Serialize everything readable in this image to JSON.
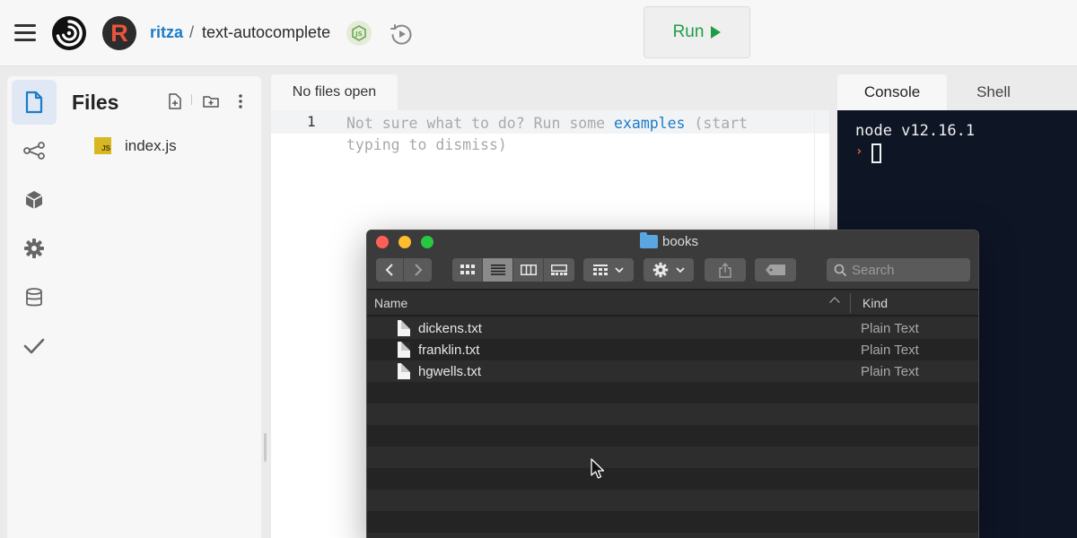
{
  "header": {
    "owner": "ritza",
    "separator": "/",
    "repl_name": "text-autocomplete",
    "run_label": "Run",
    "avatar_letter": "R"
  },
  "rail": {
    "items": [
      "files-icon",
      "version-control-icon",
      "packages-icon",
      "settings-icon",
      "database-icon",
      "unit-tests-icon"
    ],
    "active_index": 0
  },
  "files_panel": {
    "title": "Files",
    "files": [
      {
        "name": "index.js",
        "icon": "js-file-icon",
        "icon_label": "JS"
      }
    ]
  },
  "editor": {
    "tab_label": "No files open",
    "line_number": "1",
    "hint_prefix": "Not sure what to do? Run some ",
    "hint_link": "examples",
    "hint_suffix": " (start typing to dismiss)"
  },
  "console": {
    "tabs": [
      "Console",
      "Shell"
    ],
    "active_tab": "Console",
    "output": "node v12.16.1",
    "prompt": "›"
  },
  "finder": {
    "title": "books",
    "search_placeholder": "Search",
    "columns": {
      "name": "Name",
      "kind": "Kind"
    },
    "files": [
      {
        "name": "dickens.txt",
        "kind": "Plain Text"
      },
      {
        "name": "franklin.txt",
        "kind": "Plain Text"
      },
      {
        "name": "hgwells.txt",
        "kind": "Plain Text"
      }
    ]
  },
  "colors": {
    "run_green": "#1e9e44",
    "link_blue": "#1c7cc8",
    "console_bg": "#0e1525",
    "finder_bg": "#252525"
  }
}
